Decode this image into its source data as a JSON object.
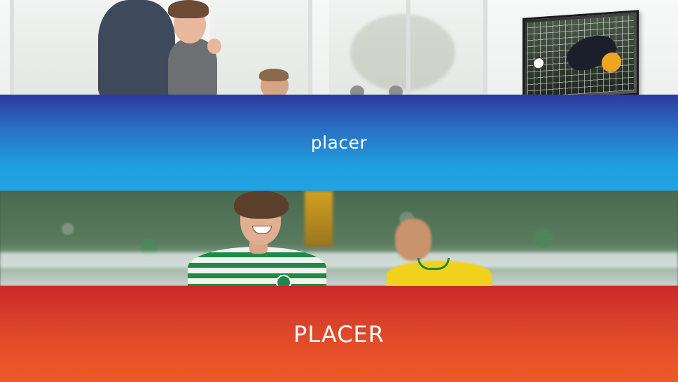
{
  "bands": {
    "blue": {
      "label": "placer",
      "color_top": "#2d3a9c",
      "color_bottom": "#23a2e2"
    },
    "orange": {
      "label": "PLACER",
      "color_top": "#c9282b",
      "color_bottom": "#ec5a27"
    }
  },
  "images": {
    "top": {
      "icon": "fans-watching-football-tv-photo"
    },
    "middle": {
      "icon": "football-players-celebration-photo"
    }
  }
}
